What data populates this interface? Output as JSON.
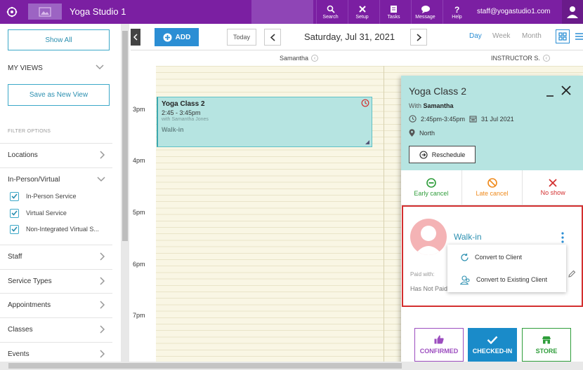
{
  "header": {
    "studio_name": "Yoga Studio 1",
    "nav": [
      {
        "label": "Search",
        "icon": "search-icon"
      },
      {
        "label": "Setup",
        "icon": "tools-icon"
      },
      {
        "label": "Tasks",
        "icon": "tasks-icon"
      },
      {
        "label": "Message",
        "icon": "message-icon"
      },
      {
        "label": "Help",
        "icon": "help-icon"
      }
    ],
    "user_email": "staff@yogastudio1.com"
  },
  "sidebar": {
    "show_all": "Show All",
    "my_views": "MY VIEWS",
    "save_view": "Save as New View",
    "filter_options": "FILTER OPTIONS",
    "locations": "Locations",
    "in_person_virtual": "In-Person/Virtual",
    "checkboxes": [
      "In-Person Service",
      "Virtual Service",
      "Non-Integrated Virtual S..."
    ],
    "sections": [
      "Staff",
      "Service Types",
      "Appointments",
      "Classes",
      "Events"
    ]
  },
  "calendar": {
    "add": "ADD",
    "today": "Today",
    "date": "Saturday, Jul 31, 2021",
    "views": [
      "Day",
      "Week",
      "Month"
    ],
    "active_view": "Day",
    "columns": [
      "Samantha",
      "INSTRUCTOR S."
    ],
    "times": [
      "3pm",
      "4pm",
      "5pm",
      "6pm",
      "7pm"
    ],
    "event": {
      "title": "Yoga Class 2",
      "time": "2:45 - 3:45pm",
      "with": "with Samantha Jones",
      "client": "Walk-in"
    }
  },
  "panel": {
    "title": "Yoga Class 2",
    "with_prefix": "With",
    "instructor": "Samantha",
    "time": "2:45pm-3:45pm",
    "date": "31 Jul 2021",
    "location": "North",
    "reschedule": "Reschedule",
    "statuses": [
      {
        "label": "Early cancel",
        "color": "#2e9d3a"
      },
      {
        "label": "Late cancel",
        "color": "#ef8a1c"
      },
      {
        "label": "No show",
        "color": "#d32f2f"
      }
    ],
    "client_name": "Walk-in",
    "paid_with": "Paid with:",
    "paid_value": "Has Not Paid",
    "menu": [
      "Convert to Client",
      "Convert to Existing Client"
    ],
    "buttons": [
      "CONFIRMED",
      "CHECKED-IN",
      "STORE"
    ]
  },
  "colors": {
    "brand": "#7b1fa2",
    "accent": "#2b8ed4",
    "event_bg": "#b6e4e1"
  }
}
